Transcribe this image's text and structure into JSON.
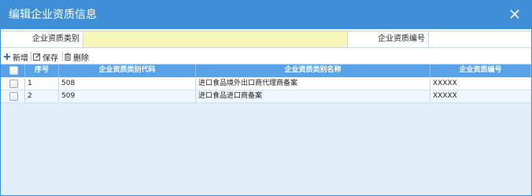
{
  "dialog": {
    "title": "编辑企业资质信息",
    "close_icon": "close-icon"
  },
  "form": {
    "type_label": "企业资质类别",
    "type_value": "",
    "number_label": "企业资质编号",
    "number_value": ""
  },
  "toolbar": {
    "add_label": "新增",
    "save_label": "保存",
    "delete_label": "删除"
  },
  "grid": {
    "columns": [
      "序号",
      "企业资质类别代码",
      "企业资质类别名称",
      "企业资质编号"
    ],
    "rows": [
      {
        "seq": "1",
        "code": "508",
        "name": "进口食品境外出口商代理商备案",
        "number": "XXXXX"
      },
      {
        "seq": "2",
        "code": "509",
        "name": "进口食品进口商备案",
        "number": "XXXXX"
      }
    ]
  },
  "colors": {
    "title_bar": "#3f8fd8",
    "header": "#5aa2e8",
    "required_input": "#f6f6b9",
    "grid_bg": "#e2effb"
  }
}
